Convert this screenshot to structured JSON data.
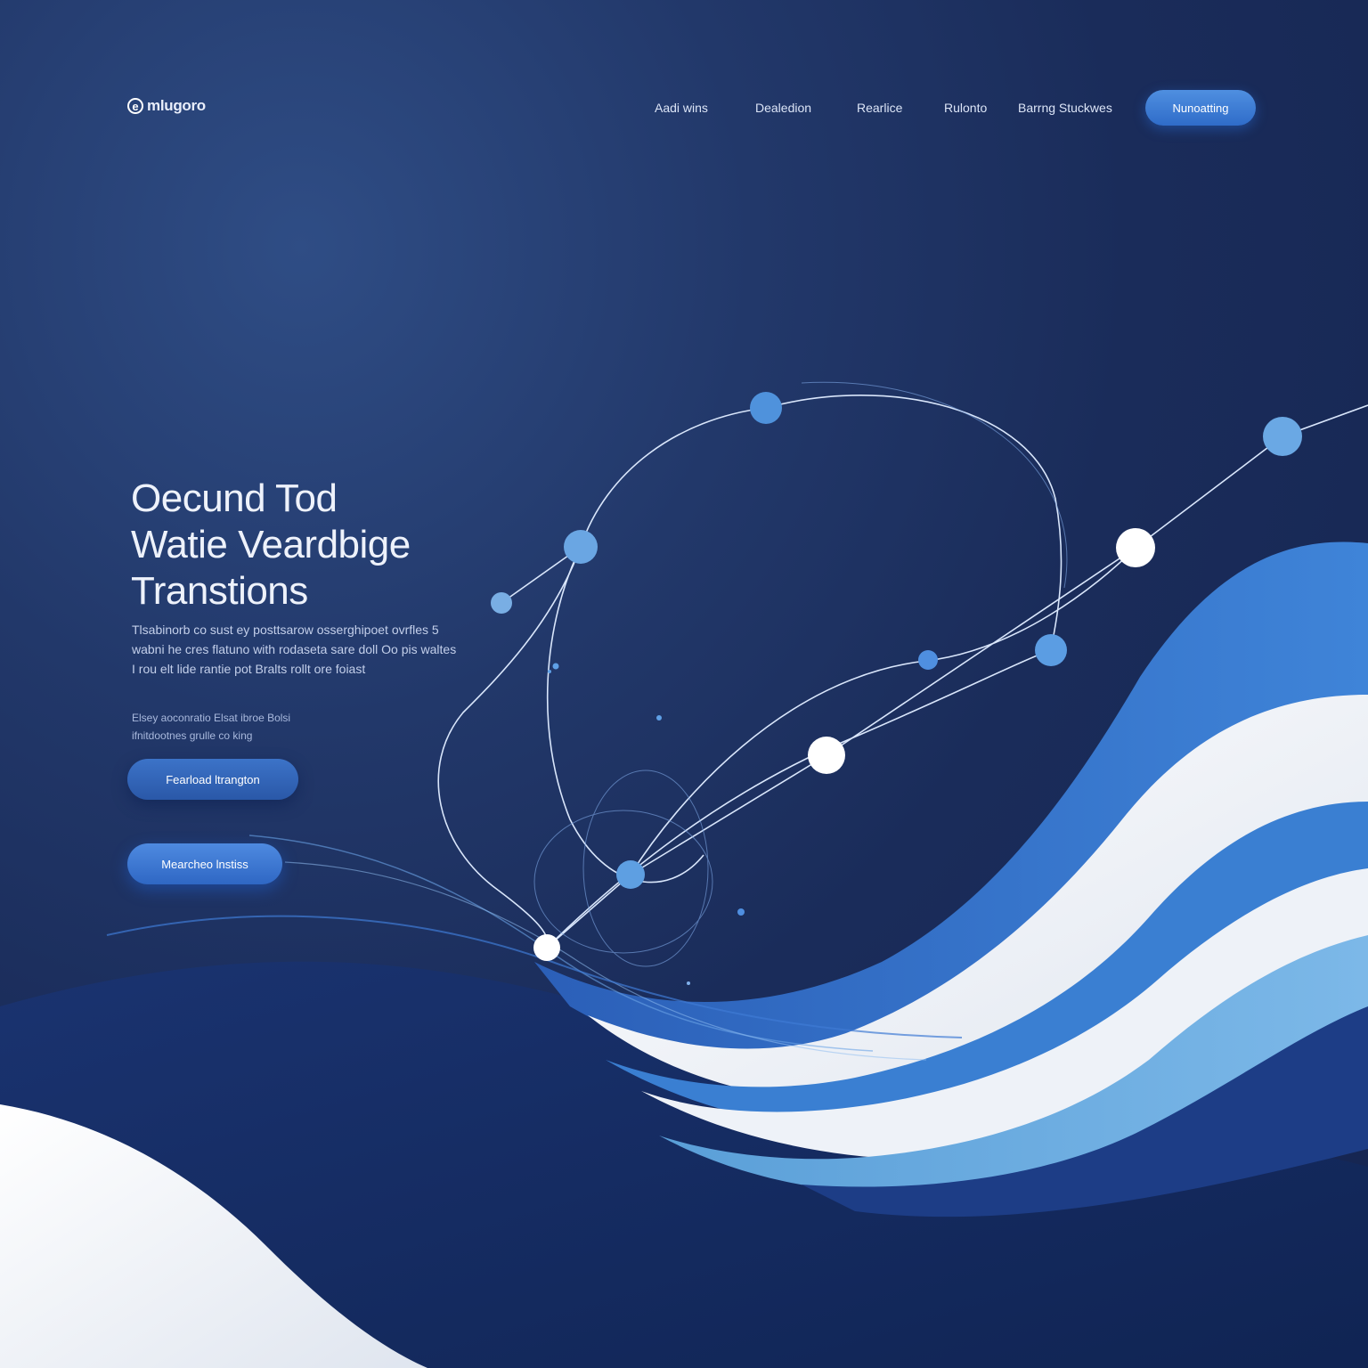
{
  "brand": {
    "logo_mark": "e",
    "name": "mlugoro"
  },
  "nav": {
    "links": [
      "Aadi wins",
      "Dealedion",
      "Rearlice",
      "Rulonto",
      "Barrng Stuckwes"
    ],
    "cta_label": "Nunoatting"
  },
  "hero": {
    "title_lines": [
      "Oecund Tod",
      "Watie Veardbige",
      "Transtions"
    ],
    "body": "Tlsabinorb co sust ey posttsarow osserghipoet ovrfles 5 wabni he cres flatuno with rodaseta sare doll Oo pis waltes I rou elt lide rantie pot Bralts rollt ore foiast",
    "note": "Elsey aoconratio Elsat ibroe Bolsi ifnitdootnes grulle co king",
    "primary_button": "Fearload ltrangton",
    "secondary_button": "Mearcheo lnstiss"
  },
  "colors": {
    "background_dark": "#152450",
    "background_mid": "#22386a",
    "accent_blue": "#3a78d4",
    "light_blue": "#5aa0e0",
    "wave_white": "#e9edf5"
  },
  "icons": {
    "logo": "circle-e-logo-icon"
  }
}
